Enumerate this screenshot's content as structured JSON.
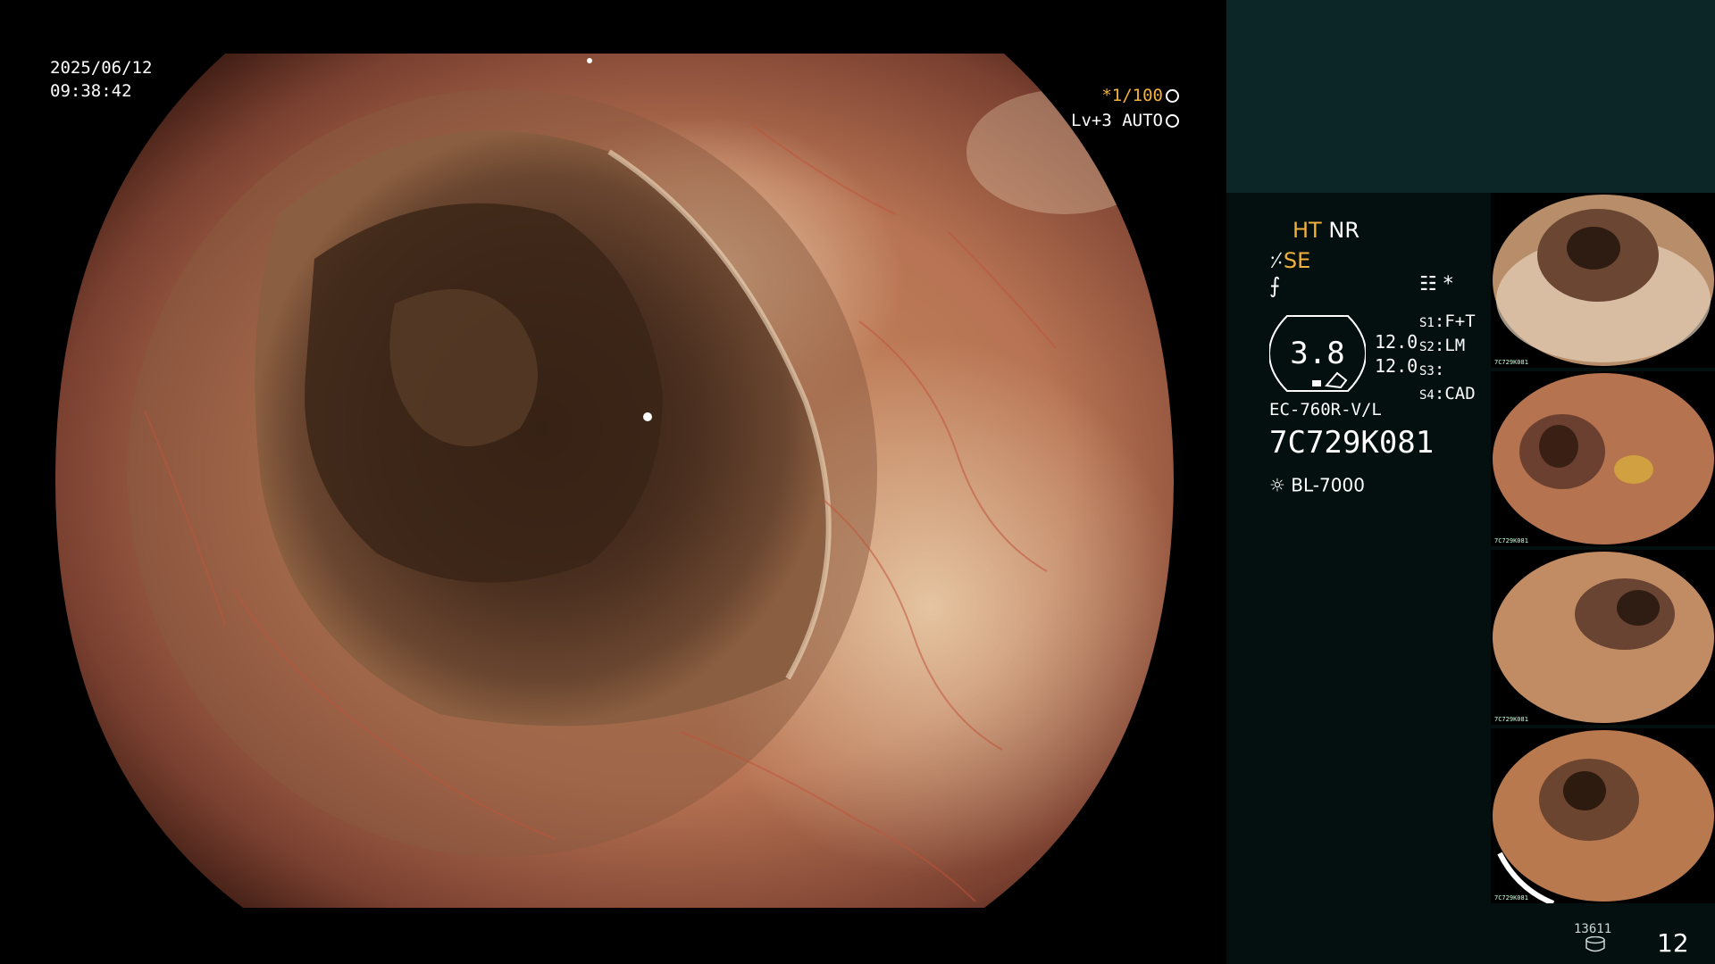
{
  "osd": {
    "date": "2025/06/12",
    "time": "09:38:42",
    "shutter": "*1/100",
    "shutter_icon": "aperture-icon",
    "level": "Lv+3 AUTO",
    "level_icon": "iris-icon"
  },
  "processor": {
    "tag_ht": "HT",
    "tag_nr": "NR",
    "tag_se": "SE",
    "se_icon": "se-mode-icon",
    "mode3_icon": "slash-f-icon",
    "menu_icon": "menu-icon",
    "asterisk": "*",
    "magnification": "3.8",
    "value_1": "12.0",
    "value_2": "12.0",
    "presets": [
      {
        "key": "S1",
        "value": "F+T"
      },
      {
        "key": "S2",
        "value": "LM"
      },
      {
        "key": "S3",
        "value": ""
      },
      {
        "key": "S4",
        "value": "CAD"
      }
    ],
    "scope_model": "EC-760R-V/L",
    "scope_serial": "7C729K081",
    "light_source": "BL-7000",
    "light_icon": "light-bulb-icon"
  },
  "thumbnails": [
    {
      "id": "thumb-1",
      "serial": "7C729K081"
    },
    {
      "id": "thumb-2",
      "serial": "7C729K081"
    },
    {
      "id": "thumb-3",
      "serial": "7C729K081"
    },
    {
      "id": "thumb-4",
      "serial": "7C729K081"
    }
  ],
  "footer": {
    "storage_count": "13611",
    "storage_icon": "storage-disk-icon",
    "image_count": "12"
  }
}
